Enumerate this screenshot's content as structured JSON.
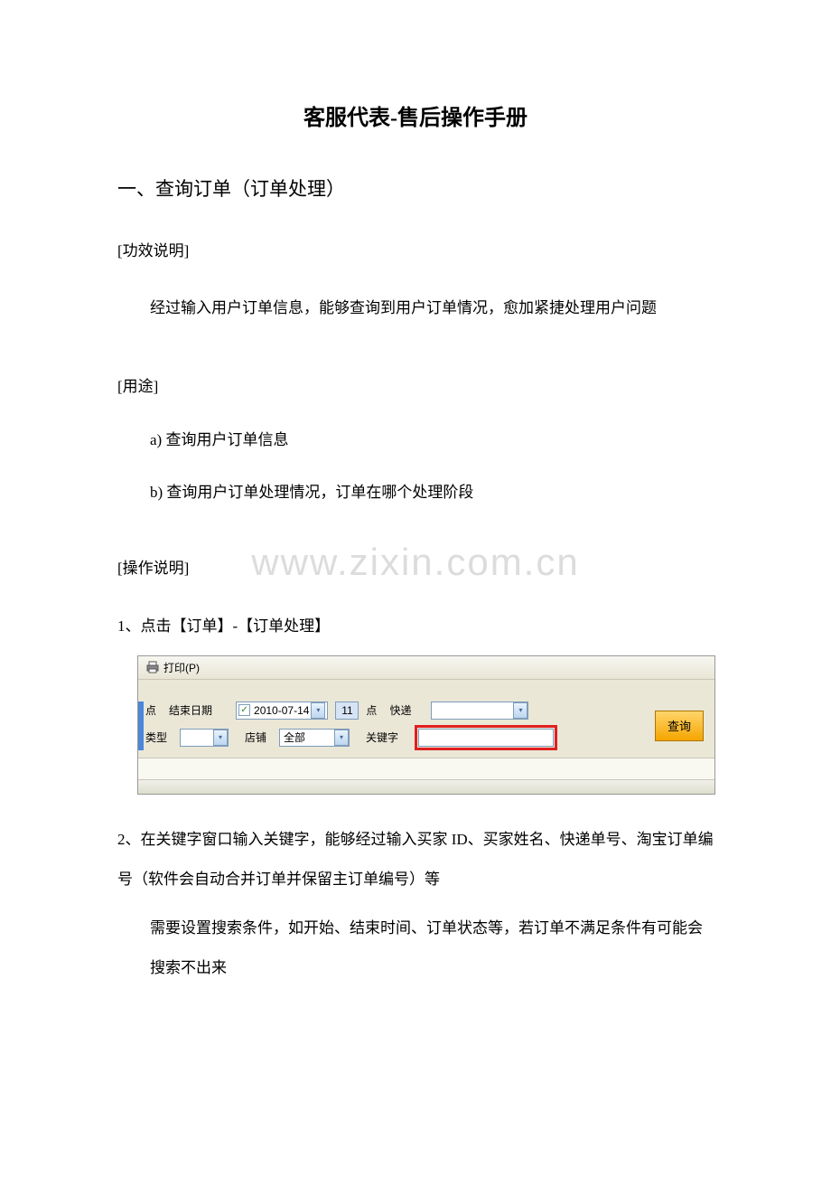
{
  "watermark": "www.zixin.com.cn",
  "doc": {
    "title": "客服代表-售后操作手册",
    "section1": "一、查询订单（订单处理）",
    "label_function": "[功效说明]",
    "function_desc": "经过输入用户订单信息，能够查询到用户订单情况，愈加紧捷处理用户问题",
    "label_usage": "[用途]",
    "usage_a": "a)  查询用户订单信息",
    "usage_b": "b)  查询用户订单处理情况，订单在哪个处理阶段",
    "label_operation": "[操作说明]",
    "step1": "1、点击【订单】-【订单处理】",
    "step2": "2、在关键字窗口输入关键字，能够经过输入买家 ID、买家姓名、快递单号、淘宝订单编号（软件会自动合并订单并保留主订单编号）等",
    "step2b": "需要设置搜索条件，如开始、结束时间、订单状态等，若订单不满足条件有可能会搜索不出来"
  },
  "screenshot": {
    "print_label": "打印(P)",
    "row1": {
      "dian1": "点",
      "end_date_label": "结束日期",
      "date_value": "2010-07-14",
      "hour_value": "11",
      "dian2": "点",
      "express_label": "快递"
    },
    "row2": {
      "type_label": "类型",
      "shop_label": "店铺",
      "shop_value": "全部",
      "keyword_label": "关键字"
    },
    "query_button": "查询"
  }
}
